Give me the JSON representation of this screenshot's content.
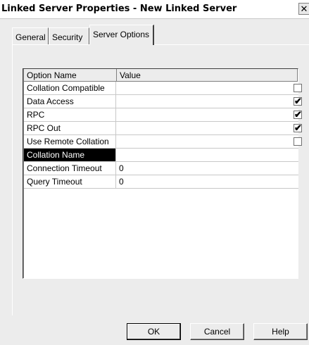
{
  "window": {
    "title": "Linked Server Properties - New Linked Server",
    "close_glyph": "✕"
  },
  "tabs": [
    {
      "label": "General"
    },
    {
      "label": "Security"
    },
    {
      "label": "Server Options",
      "active": true
    }
  ],
  "grid": {
    "headers": {
      "name": "Option Name",
      "value": "Value"
    },
    "rows": [
      {
        "name": "Collation Compatible",
        "type": "checkbox",
        "checked": false,
        "value": ""
      },
      {
        "name": "Data Access",
        "type": "checkbox",
        "checked": true,
        "value": ""
      },
      {
        "name": "RPC",
        "type": "checkbox",
        "checked": true,
        "value": ""
      },
      {
        "name": "RPC Out",
        "type": "checkbox",
        "checked": true,
        "value": ""
      },
      {
        "name": "Use Remote Collation",
        "type": "checkbox",
        "checked": false,
        "value": ""
      },
      {
        "name": "Collation Name",
        "type": "text",
        "selected": true,
        "value": ""
      },
      {
        "name": "Connection Timeout",
        "type": "text",
        "value": "0"
      },
      {
        "name": "Query Timeout",
        "type": "text",
        "value": "0"
      }
    ]
  },
  "buttons": {
    "ok": "OK",
    "cancel": "Cancel",
    "help": "Help"
  },
  "colors": {
    "selection": "#000000",
    "dialog_bg": "#ececec"
  }
}
